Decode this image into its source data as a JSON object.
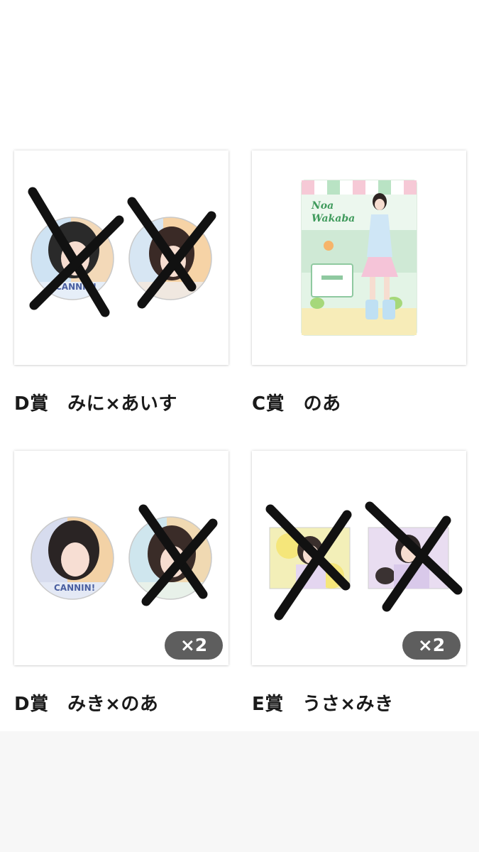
{
  "items": [
    {
      "caption": "D賞　みに×あいす",
      "crossed": [
        true,
        true
      ]
    },
    {
      "caption": "C賞　のあ",
      "crossed": []
    },
    {
      "caption": "D賞　みき×のあ",
      "crossed": [
        false,
        true
      ],
      "badge": "×2"
    },
    {
      "caption": "E賞　うさ×みき",
      "crossed": [
        true,
        true
      ],
      "badge": "×2"
    }
  ],
  "colors": {
    "cross": "#111111",
    "badge_bg": "#5e5e5e",
    "caption_text": "#1a1a1a"
  }
}
